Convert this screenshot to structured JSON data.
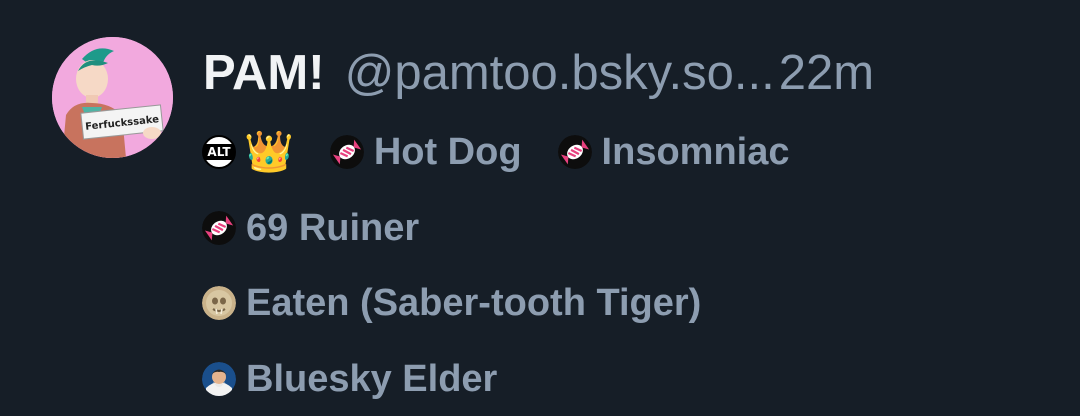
{
  "post": {
    "display_name": "PAM!",
    "handle": "@pamtoo.bsky.so...",
    "time": "22m",
    "avatar_sign_text": "Ferfuckssake"
  },
  "badges": {
    "alt_label": "ALT",
    "crown_emoji": "👑",
    "items": [
      {
        "label": "Hot Dog",
        "icon": "candy-icon"
      },
      {
        "label": "Insomniac",
        "icon": "candy-icon"
      },
      {
        "label": "69 Ruiner",
        "icon": "candy-icon"
      },
      {
        "label": "Eaten (Saber-tooth Tiger)",
        "icon": "fossil-icon"
      },
      {
        "label": "Bluesky Elder",
        "icon": "elder-icon"
      }
    ]
  },
  "colors": {
    "background": "#161e27",
    "name": "#f1f3f5",
    "muted": "#8d9db0",
    "avatar_bg": "#f0a6dc"
  }
}
